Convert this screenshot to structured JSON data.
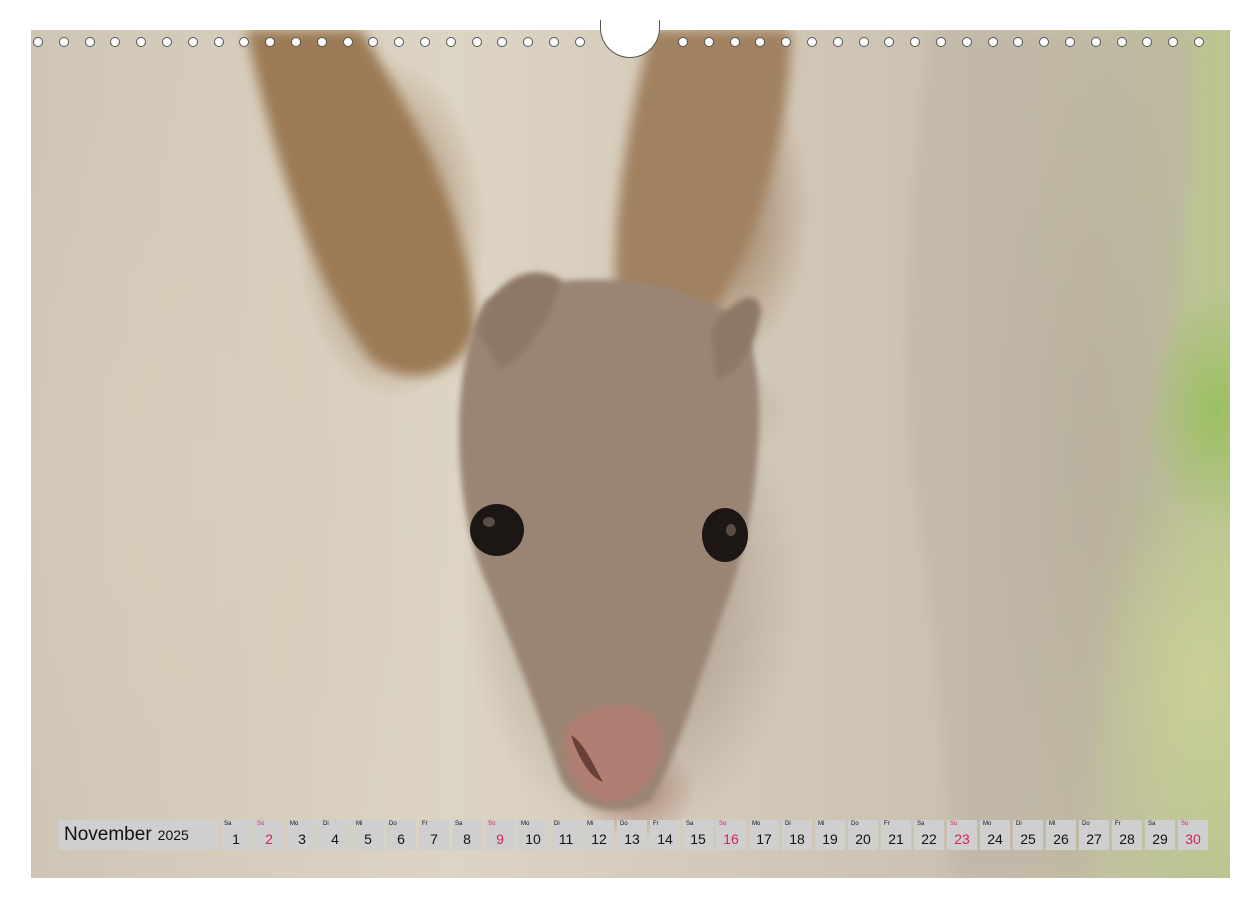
{
  "calendar": {
    "month": "November",
    "year": "2025",
    "days": [
      {
        "wd": "Sa",
        "num": "1",
        "sunday": false
      },
      {
        "wd": "So",
        "num": "2",
        "sunday": true
      },
      {
        "wd": "Mo",
        "num": "3",
        "sunday": false
      },
      {
        "wd": "Di",
        "num": "4",
        "sunday": false
      },
      {
        "wd": "Mi",
        "num": "5",
        "sunday": false
      },
      {
        "wd": "Do",
        "num": "6",
        "sunday": false
      },
      {
        "wd": "Fr",
        "num": "7",
        "sunday": false
      },
      {
        "wd": "Sa",
        "num": "8",
        "sunday": false
      },
      {
        "wd": "So",
        "num": "9",
        "sunday": true
      },
      {
        "wd": "Mo",
        "num": "10",
        "sunday": false
      },
      {
        "wd": "Di",
        "num": "11",
        "sunday": false
      },
      {
        "wd": "Mi",
        "num": "12",
        "sunday": false
      },
      {
        "wd": "Do",
        "num": "13",
        "sunday": false
      },
      {
        "wd": "Fr",
        "num": "14",
        "sunday": false
      },
      {
        "wd": "Sa",
        "num": "15",
        "sunday": false
      },
      {
        "wd": "So",
        "num": "16",
        "sunday": true
      },
      {
        "wd": "Mo",
        "num": "17",
        "sunday": false
      },
      {
        "wd": "Di",
        "num": "18",
        "sunday": false
      },
      {
        "wd": "Mi",
        "num": "19",
        "sunday": false
      },
      {
        "wd": "Do",
        "num": "20",
        "sunday": false
      },
      {
        "wd": "Fr",
        "num": "21",
        "sunday": false
      },
      {
        "wd": "Sa",
        "num": "22",
        "sunday": false
      },
      {
        "wd": "So",
        "num": "23",
        "sunday": true
      },
      {
        "wd": "Mo",
        "num": "24",
        "sunday": false
      },
      {
        "wd": "Di",
        "num": "25",
        "sunday": false
      },
      {
        "wd": "Mi",
        "num": "26",
        "sunday": false
      },
      {
        "wd": "Do",
        "num": "27",
        "sunday": false
      },
      {
        "wd": "Fr",
        "num": "28",
        "sunday": false
      },
      {
        "wd": "Sa",
        "num": "29",
        "sunday": false
      },
      {
        "wd": "So",
        "num": "30",
        "sunday": true
      }
    ]
  },
  "colors": {
    "cell_background": "#cfcfcf",
    "sunday_text": "#d4245a",
    "weekday_text": "#111111"
  },
  "photo": {
    "subject": "kangaroo-joey-in-pouch"
  }
}
